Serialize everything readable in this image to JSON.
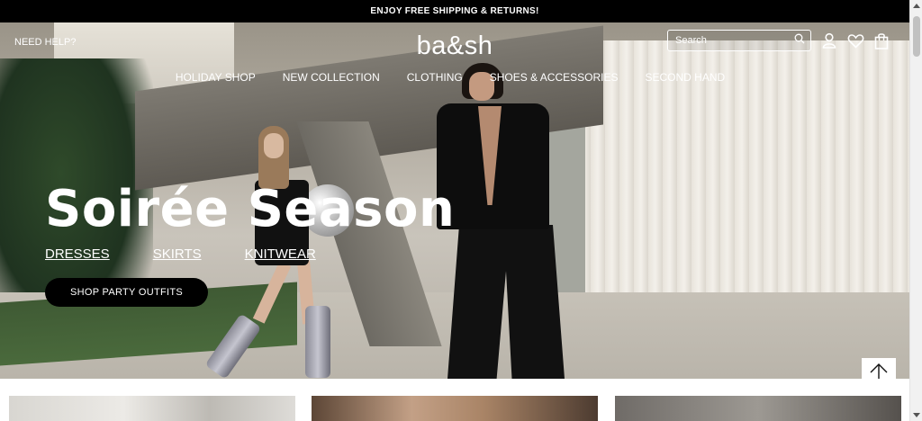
{
  "promo": {
    "text": "ENJOY FREE SHIPPING & RETURNS!"
  },
  "header": {
    "need_help": "NEED HELP?",
    "logo": "ba&sh",
    "search": {
      "placeholder": "Search",
      "value": ""
    },
    "icons": [
      "search-icon",
      "account-icon",
      "wishlist-icon",
      "bag-icon"
    ]
  },
  "nav": {
    "items": [
      {
        "label": "HOLIDAY SHOP"
      },
      {
        "label": "NEW COLLECTION"
      },
      {
        "label": "CLOTHING"
      },
      {
        "label": "SHOES & ACCESSORIES"
      },
      {
        "label": "SECOND HAND"
      }
    ]
  },
  "hero": {
    "title": "Soirée Season",
    "links": [
      {
        "label": "DRESSES"
      },
      {
        "label": "SKIRTS"
      },
      {
        "label": "KNITWEAR"
      }
    ],
    "cta": "SHOP PARTY OUTFITS"
  },
  "back_to_top": {
    "icon": "arrow-up-icon"
  },
  "colors": {
    "header_bar": "#000000",
    "text_on_hero": "#ffffff",
    "cta_bg": "#000000"
  }
}
